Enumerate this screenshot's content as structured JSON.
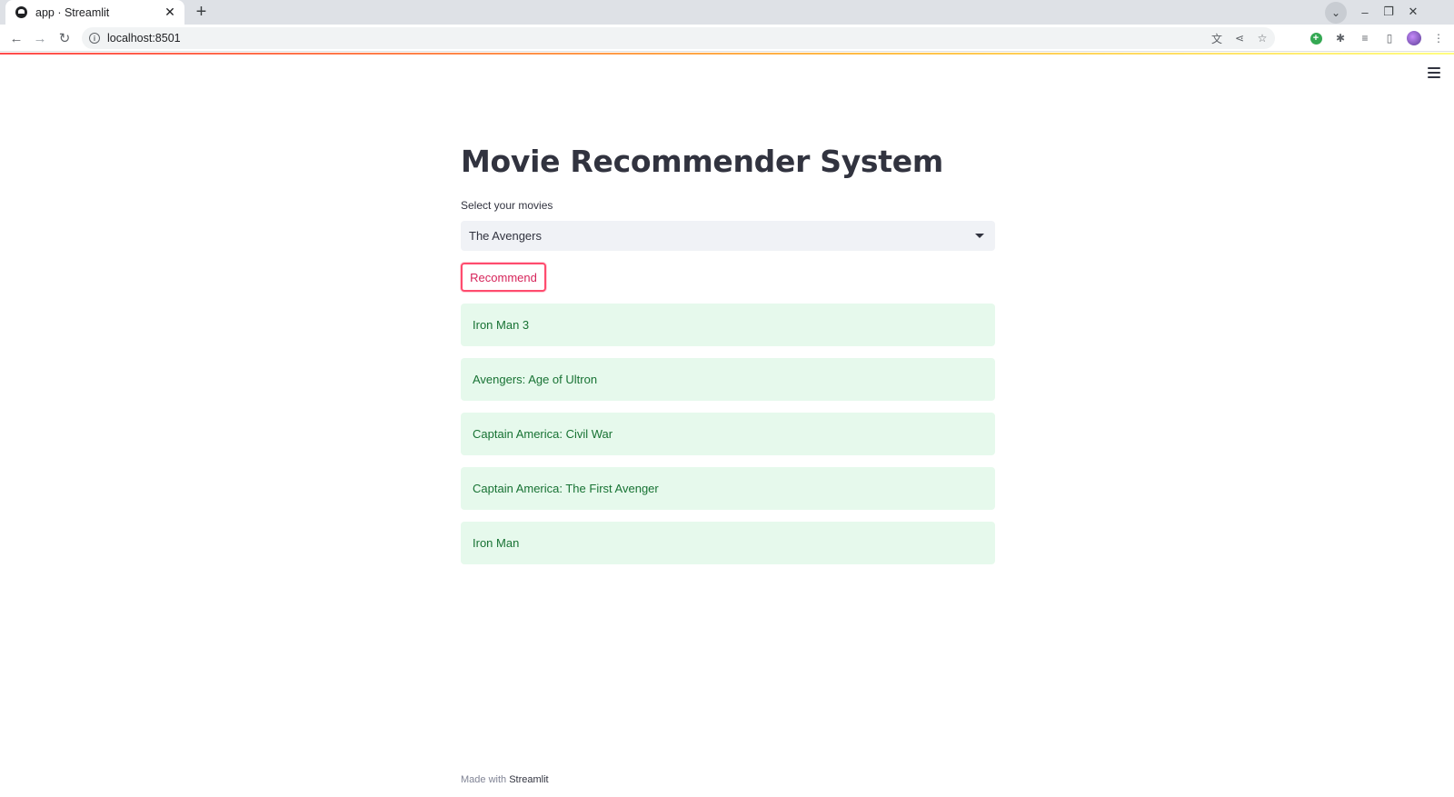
{
  "browser": {
    "tab_title": "app · Streamlit",
    "tab_close": "✕",
    "new_tab": "+",
    "url": "localhost:8501"
  },
  "app": {
    "title": "Movie Recommender System",
    "select_label": "Select your movies",
    "select_value": "The Avengers",
    "button_label": "Recommend",
    "recommendations": [
      "Iron Man 3",
      "Avengers: Age of Ultron",
      "Captain America: Civil War",
      "Captain America: The First Avenger",
      "Iron Man"
    ],
    "footer_prefix": "Made with",
    "footer_brand": "Streamlit"
  },
  "colors": {
    "primary": "#ff4b4b",
    "button_border": "#ff4b6e",
    "success_bg": "#e6f9ec",
    "success_text": "#177233",
    "text": "#31333f"
  }
}
